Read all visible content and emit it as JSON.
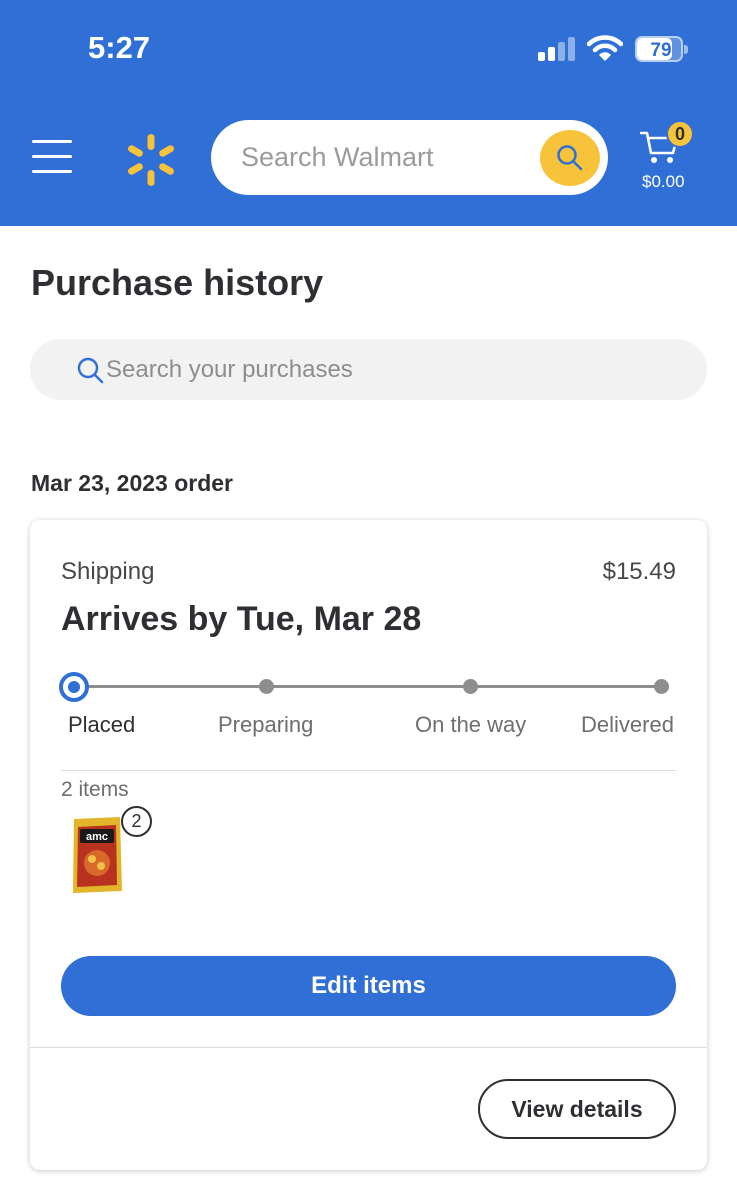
{
  "status_bar": {
    "time": "5:27",
    "battery": "79",
    "battery_level": 0.79
  },
  "header": {
    "search_placeholder": "Search Walmart",
    "cart_count": "0",
    "cart_total": "$0.00",
    "brand_color": "#2f6fd6",
    "accent_color": "#f6c33b"
  },
  "page": {
    "title": "Purchase history",
    "search_placeholder": "Search your purchases"
  },
  "order": {
    "date_heading": "Mar 23, 2023 order",
    "method": "Shipping",
    "price": "$15.49",
    "arrival": "Arrives by Tue, Mar 28",
    "steps": [
      "Placed",
      "Preparing",
      "On the way",
      "Delivered"
    ],
    "current_step": 0,
    "items_count": "2 items",
    "item_quantity": "2",
    "product_logo": "amc",
    "edit_label": "Edit items",
    "details_label": "View details"
  }
}
